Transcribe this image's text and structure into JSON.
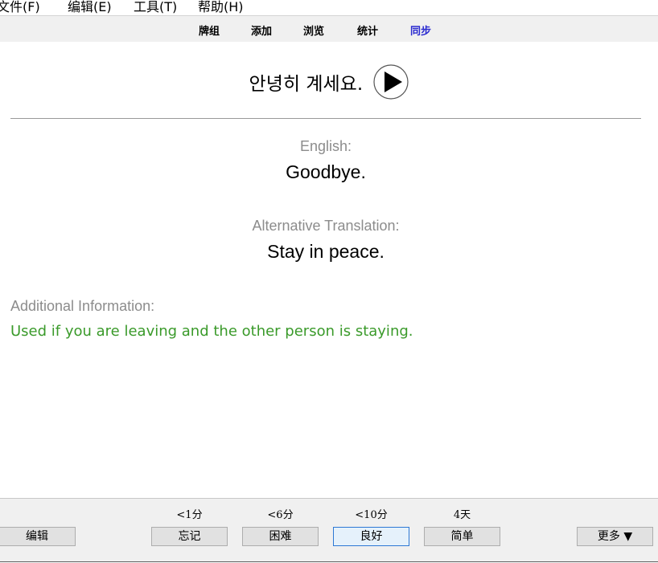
{
  "menubar": {
    "items": [
      "文件(F)",
      "编辑(E)",
      "工具(T)",
      "帮助(H)"
    ]
  },
  "toolbar": {
    "decks": "牌组",
    "add": "添加",
    "browse": "浏览",
    "stats": "统计",
    "sync": "同步"
  },
  "card": {
    "front": "안녕히 계세요.",
    "english_label": "English:",
    "english_value": "Goodbye.",
    "alt_label": "Alternative Translation:",
    "alt_value": "Stay in peace.",
    "info_label": "Additional Information:",
    "info_value": "Used if you are leaving and the other person is staying."
  },
  "answer_bar": {
    "edit_label": "编辑",
    "more_label": "更多 ▼",
    "options": [
      {
        "due": "<1分",
        "label": "忘记"
      },
      {
        "due": "<6分",
        "label": "困难"
      },
      {
        "due": "<10分",
        "label": "良好"
      },
      {
        "due": "4天",
        "label": "简单"
      }
    ]
  },
  "colors": {
    "sync_link": "#2a2ad0",
    "info_text": "#3a9a2a",
    "label_gray": "#8c8c8c",
    "default_button_border": "#2c78d4"
  }
}
